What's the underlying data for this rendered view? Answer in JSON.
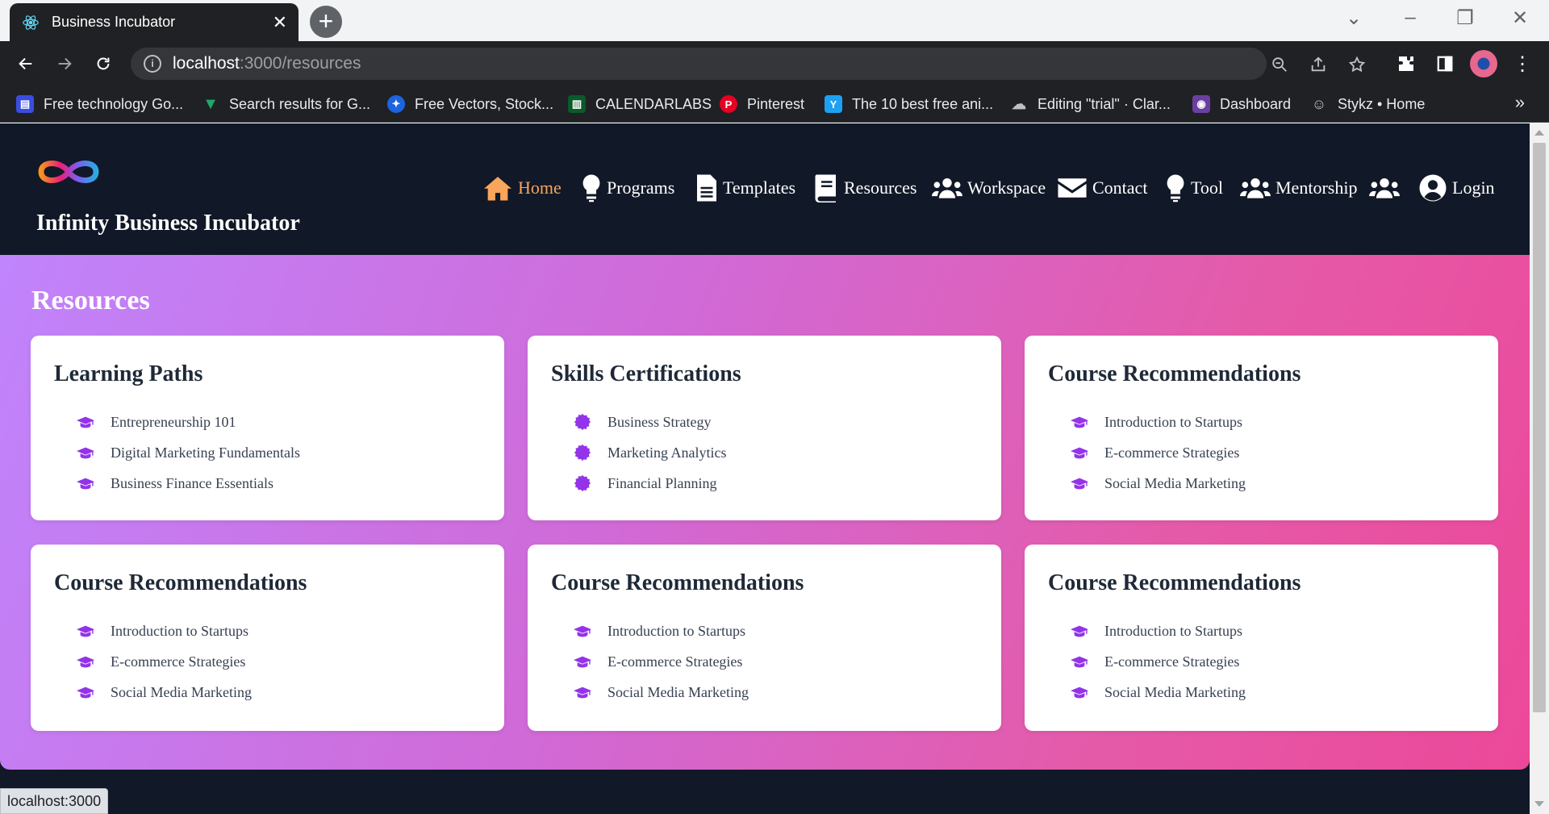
{
  "browser": {
    "tab_title": "Business Incubator",
    "tab_icon": "react-icon",
    "url_host": "localhost",
    "url_path": ":3000/resources",
    "bookmarks": [
      {
        "label": "Free technology Go...",
        "icon": "bookmark-icon"
      },
      {
        "label": "Search results for G...",
        "icon": "vuetify-icon"
      },
      {
        "label": "Free Vectors, Stock...",
        "icon": "freepik-icon"
      },
      {
        "label": "CALENDARLABS",
        "icon": "calendar-icon"
      },
      {
        "label": "Pinterest",
        "icon": "pinterest-icon"
      },
      {
        "label": "The 10 best free ani...",
        "icon": "site-icon"
      },
      {
        "label": "Editing \"trial\" · Clar...",
        "icon": "cloud-icon"
      },
      {
        "label": "Dashboard",
        "icon": "dashboard-icon"
      },
      {
        "label": "Stykz • Home",
        "icon": "stykz-icon"
      }
    ],
    "status_text": "localhost:3000"
  },
  "header": {
    "brand": "Infinity Business Incubator",
    "nav": [
      {
        "label": "Home",
        "icon": "home-icon",
        "active": true
      },
      {
        "label": "Programs",
        "icon": "lightbulb-icon"
      },
      {
        "label": "Templates",
        "icon": "file-icon"
      },
      {
        "label": "Resources",
        "icon": "book-icon"
      },
      {
        "label": "Workspace",
        "icon": "users-icon"
      },
      {
        "label": "Contact",
        "icon": "envelope-icon"
      },
      {
        "label": "Tool",
        "icon": "lightbulb-icon"
      },
      {
        "label": "Mentorship",
        "icon": "users-icon"
      },
      {
        "label": "",
        "icon": "users-icon"
      },
      {
        "label": "Login",
        "icon": "user-circle-icon"
      }
    ]
  },
  "main": {
    "title": "Resources",
    "cards": [
      {
        "title": "Learning Paths",
        "icon": "graduation-cap-icon",
        "items": [
          "Entrepreneurship 101",
          "Digital Marketing Fundamentals",
          "Business Finance Essentials"
        ]
      },
      {
        "title": "Skills Certifications",
        "icon": "certificate-icon",
        "items": [
          "Business Strategy",
          "Marketing Analytics",
          "Financial Planning"
        ]
      },
      {
        "title": "Course Recommendations",
        "icon": "graduation-cap-icon",
        "items": [
          "Introduction to Startups",
          "E-commerce Strategies",
          "Social Media Marketing"
        ]
      },
      {
        "title": "Course Recommendations",
        "icon": "graduation-cap-icon",
        "items": [
          "Introduction to Startups",
          "E-commerce Strategies",
          "Social Media Marketing"
        ]
      },
      {
        "title": "Course Recommendations",
        "icon": "graduation-cap-icon",
        "items": [
          "Introduction to Startups",
          "E-commerce Strategies",
          "Social Media Marketing"
        ]
      },
      {
        "title": "Course Recommendations",
        "icon": "graduation-cap-icon",
        "items": [
          "Introduction to Startups",
          "E-commerce Strategies",
          "Social Media Marketing"
        ]
      }
    ]
  },
  "colors": {
    "header_bg": "#111827",
    "nav_active": "#f9a55b",
    "gradient_start": "#c084fc",
    "gradient_end": "#ec4899",
    "list_icon": "#9333ea"
  }
}
